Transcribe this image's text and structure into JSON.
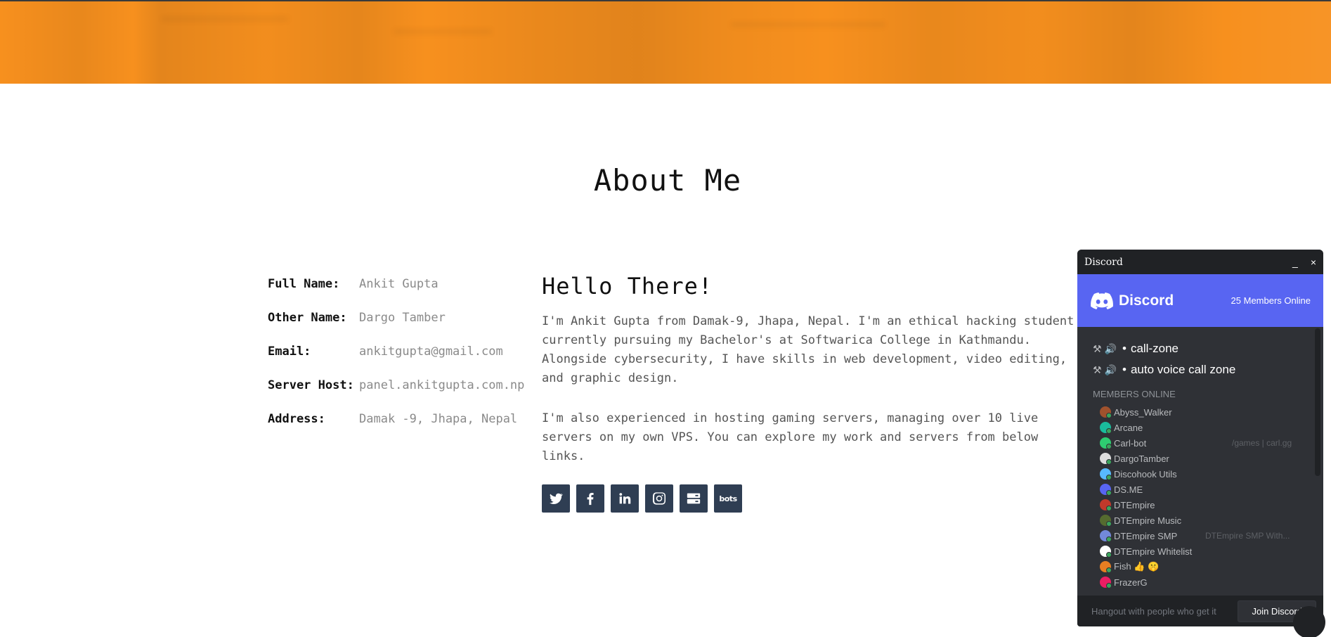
{
  "section": {
    "title": "About Me"
  },
  "info": [
    {
      "label": "Full Name:",
      "value": "Ankit Gupta"
    },
    {
      "label": "Other Name:",
      "value": "Dargo Tamber"
    },
    {
      "label": "Email:",
      "value": "ankitgupta@gmail.com"
    },
    {
      "label": "Server Host:",
      "value": "panel.ankitgupta.com.np"
    },
    {
      "label": "Address:",
      "value": "Damak -9, Jhapa, Nepal"
    }
  ],
  "hello": {
    "title": "Hello There!",
    "para1": "I'm Ankit Gupta from Damak-9, Jhapa, Nepal. I'm an ethical hacking student currently pursuing my Bachelor's at Softwarica College in Kathmandu. Alongside cybersecurity, I have skills in web development, video editing, and graphic design.",
    "para2": "I'm also experienced in hosting gaming servers, managing over 10 live servers on my own VPS. You can explore my work and servers from below links."
  },
  "socials": [
    {
      "name": "twitter-icon"
    },
    {
      "name": "facebook-icon"
    },
    {
      "name": "linkedin-icon"
    },
    {
      "name": "instagram-icon"
    },
    {
      "name": "server-icon"
    },
    {
      "name": "bots-icon",
      "text": "bots"
    }
  ],
  "colors": {
    "banner": "#f7901e",
    "social_bg": "#2f3e53",
    "discord_blurple": "#5865f2",
    "discord_bg": "#2f3136"
  },
  "discord": {
    "window_title": "Discord",
    "minimize": "_",
    "close": "×",
    "brand": "Discord",
    "members_online": "25 Members Online",
    "channels": [
      {
        "name": "call-zone"
      },
      {
        "name": "auto voice call zone"
      }
    ],
    "members_header": "MEMBERS ONLINE",
    "members": [
      {
        "name": "Abyss_Walker",
        "game": "",
        "color": "#a0522d"
      },
      {
        "name": "Arcane",
        "game": "",
        "color": "#1abc9c"
      },
      {
        "name": "Carl-bot",
        "game": "/games | carl.gg",
        "color": "#2ecc71"
      },
      {
        "name": "DargoTamber",
        "game": "",
        "color": "#dddddd"
      },
      {
        "name": "Discohook Utils",
        "game": "",
        "color": "#58b9ff"
      },
      {
        "name": "DS.ME",
        "game": "",
        "color": "#5865f2"
      },
      {
        "name": "DTEmpire",
        "game": "",
        "color": "#c0392b"
      },
      {
        "name": "DTEmpire Music",
        "game": "",
        "color": "#556b2f"
      },
      {
        "name": "DTEmpire SMP",
        "game": "DTEmpire SMP With...",
        "color": "#7289da"
      },
      {
        "name": "DTEmpire Whitelist",
        "game": "",
        "color": "#ffffff"
      },
      {
        "name": "Fish 👍 🤫",
        "game": "",
        "color": "#e67e22"
      },
      {
        "name": "FrazerG",
        "game": "",
        "color": "#e91e63"
      }
    ],
    "footer_tagline": "Hangout with people who get it",
    "join_label": "Join Discord"
  }
}
